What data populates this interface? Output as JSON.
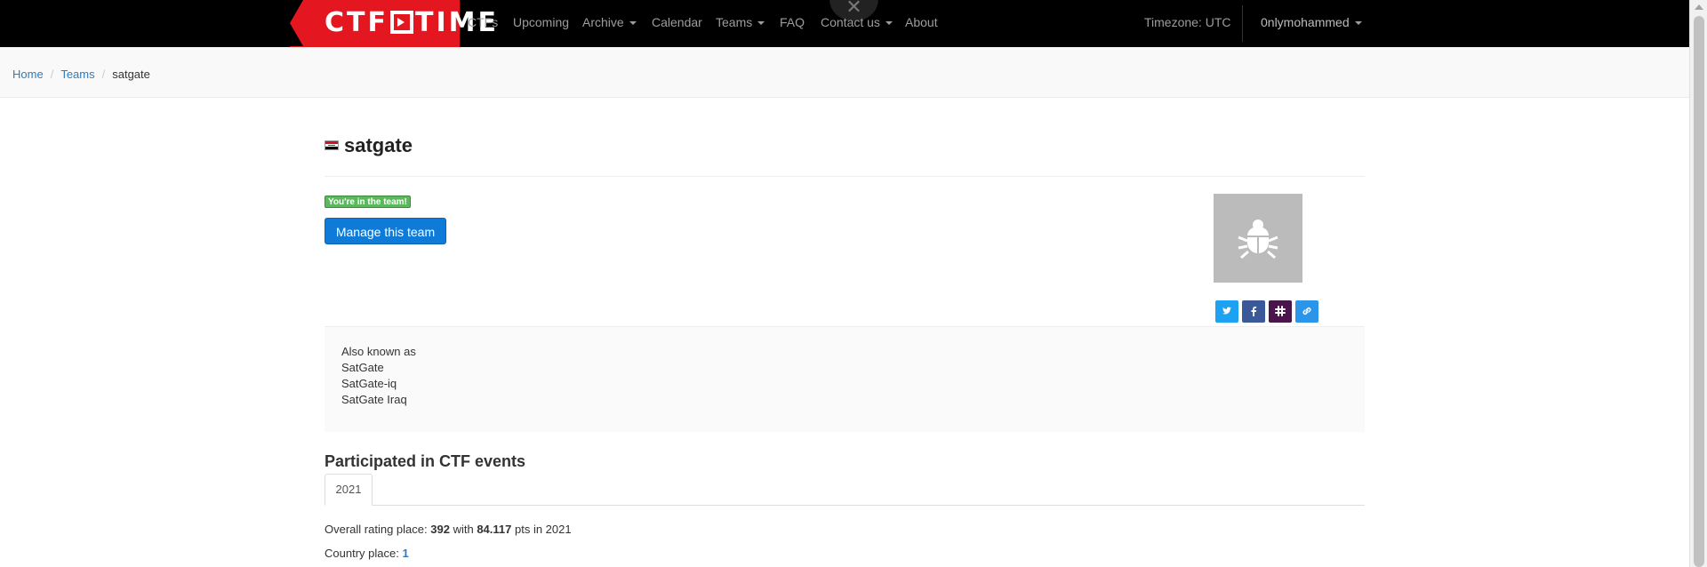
{
  "nav": {
    "logo_left": "CTF",
    "logo_right": "TIME",
    "items": [
      {
        "label": "CTFs",
        "dropdown": false
      },
      {
        "label": "Upcoming",
        "dropdown": false
      },
      {
        "label": "Archive",
        "dropdown": true
      },
      {
        "label": "Calendar",
        "dropdown": false
      },
      {
        "label": "Teams",
        "dropdown": true
      },
      {
        "label": "FAQ",
        "dropdown": false
      },
      {
        "label": "Contact us",
        "dropdown": true
      },
      {
        "label": "About",
        "dropdown": false
      }
    ],
    "timezone": "Timezone: UTC",
    "user": "0nlymohammed",
    "close_glyph": "✕"
  },
  "breadcrumb": {
    "home": "Home",
    "teams": "Teams",
    "current": "satgate",
    "separator": "/"
  },
  "team": {
    "name": "satgate",
    "flag": "iraq-flag",
    "member_badge": "You're in the team!",
    "manage_button": "Manage this team",
    "avatar_icon": "bug-icon",
    "social_icons": [
      "twitter-icon",
      "facebook-icon",
      "slack-icon",
      "link-icon"
    ]
  },
  "aka": {
    "heading": "Also known as",
    "names": [
      "SatGate",
      "SatGate-iq",
      "SatGate Iraq"
    ]
  },
  "events": {
    "title": "Participated in CTF events",
    "tabs": [
      "2021"
    ],
    "overall": {
      "prefix": "Overall rating place:",
      "place": "392",
      "with": "with",
      "points": "84.117",
      "suffix": "pts in 2021"
    },
    "country": {
      "prefix": "Country place:",
      "place": "1"
    }
  },
  "colors": {
    "navbar": "#000000",
    "logo_bg": "#e4161f",
    "link": "#337ab7",
    "badge": "#5cb85c",
    "primary_button": "#0f7bd8",
    "twitter": "#1da1f2",
    "facebook": "#3b5998",
    "slack": "#4a154b"
  }
}
